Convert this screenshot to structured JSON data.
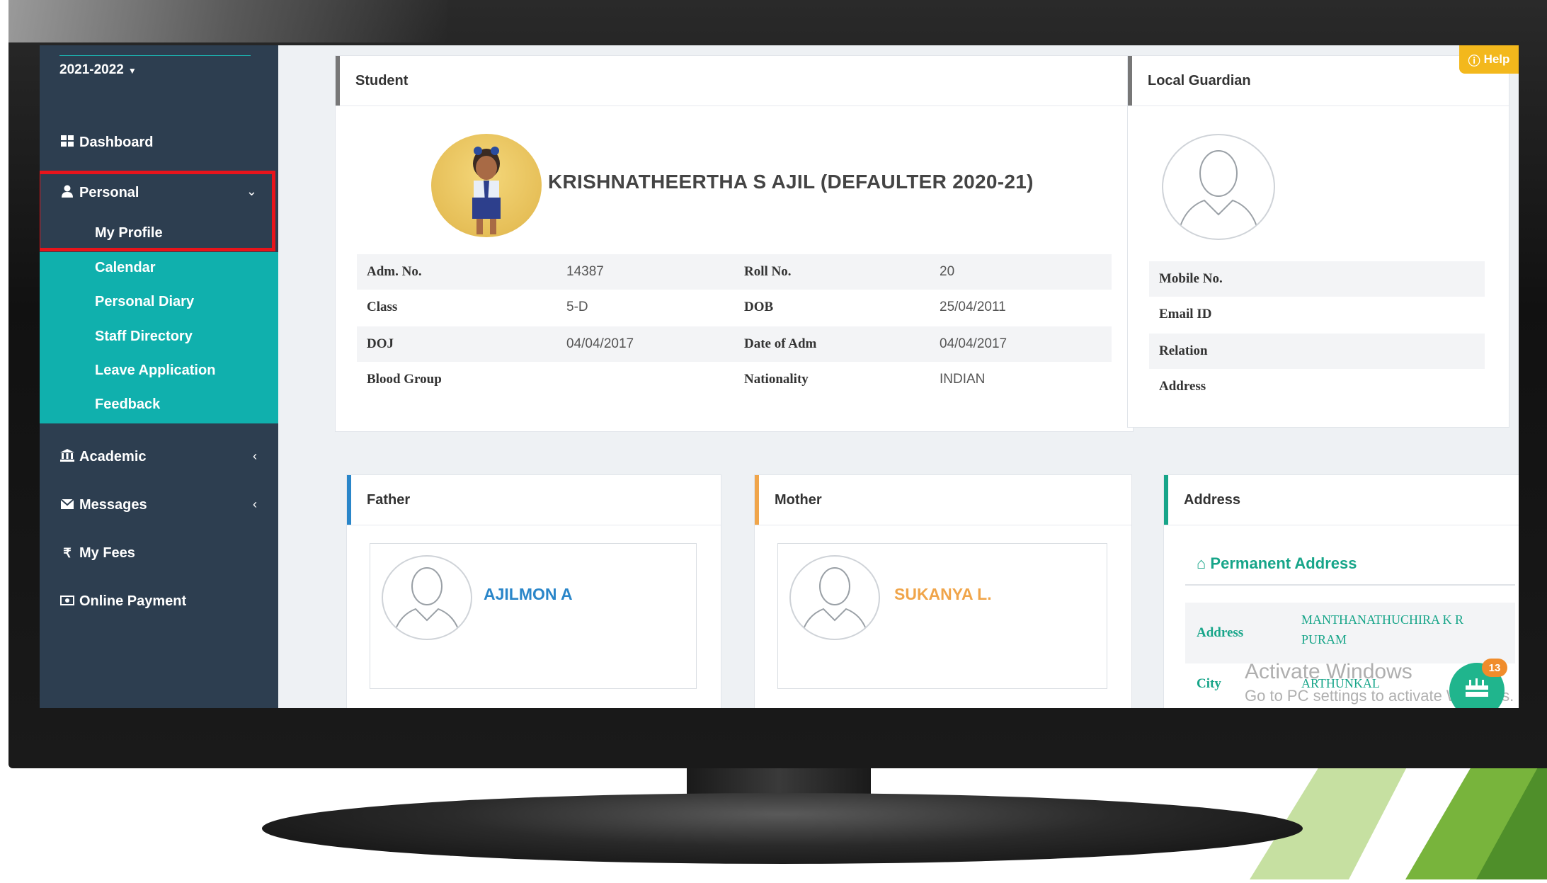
{
  "sidebar": {
    "academic_year": "2021-2022",
    "items": [
      {
        "label": "Dashboard"
      },
      {
        "label": "Personal"
      },
      {
        "label": "Academic"
      },
      {
        "label": "Messages"
      },
      {
        "label": "My Fees"
      },
      {
        "label": "Online Payment"
      }
    ],
    "personal_submenu": [
      "My Profile",
      "Calendar",
      "Personal Diary",
      "Staff Directory",
      "Leave Application",
      "Feedback"
    ]
  },
  "help_label": "Help",
  "student": {
    "panel_title": "Student",
    "name": "KRISHNATHEERTHA S AJIL (DEFAULTER 2020-21)",
    "fields": [
      {
        "label": "Adm. No.",
        "value": "14387"
      },
      {
        "label": "Roll No.",
        "value": "20"
      },
      {
        "label": "Class",
        "value": "5-D"
      },
      {
        "label": "DOB",
        "value": "25/04/2011"
      },
      {
        "label": "DOJ",
        "value": "04/04/2017"
      },
      {
        "label": "Date of Adm",
        "value": "04/04/2017"
      },
      {
        "label": "Blood Group",
        "value": ""
      },
      {
        "label": "Nationality",
        "value": "INDIAN"
      }
    ]
  },
  "guardian": {
    "panel_title": "Local Guardian",
    "fields": [
      "Mobile No.",
      "Email ID",
      "Relation",
      "Address"
    ]
  },
  "father": {
    "panel_title": "Father",
    "name": "AJILMON A"
  },
  "mother": {
    "panel_title": "Mother",
    "name": "SUKANYA L."
  },
  "address": {
    "panel_title": "Address",
    "section_title": "Permanent Address",
    "rows": [
      {
        "label": "Address",
        "value": "MANTHANATHUCHIRA K R PURAM"
      },
      {
        "label": "City",
        "value": "ARTHUNKAL"
      }
    ]
  },
  "watermark": {
    "line1": "Activate Windows",
    "line2": "Go to PC settings to activate Windows."
  },
  "chat_badge_count": "13",
  "colors": {
    "sidebar_bg": "#2d3e50",
    "submenu_bg": "#10b0ad",
    "highlight_border": "#e8141b",
    "help_bg": "#f3b81c",
    "father_accent": "#2a86c9",
    "mother_accent": "#f0a54a",
    "address_accent": "#17a589"
  }
}
